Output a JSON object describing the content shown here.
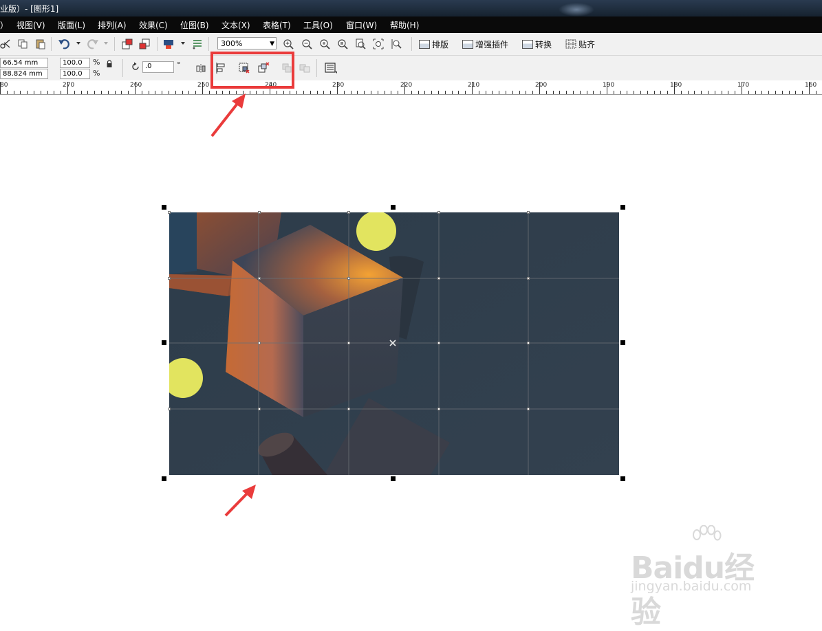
{
  "window": {
    "title": "业版）- [图形1]"
  },
  "menu": [
    "）",
    "视图(V)",
    "版面(L)",
    "排列(A)",
    "效果(C)",
    "位图(B)",
    "文本(X)",
    "表格(T)",
    "工具(O)",
    "窗口(W)",
    "帮助(H)"
  ],
  "toolbar": {
    "zoom_value": "300%",
    "plugins": [
      "排版",
      "增强插件",
      "转换",
      "贴齐"
    ]
  },
  "property_bar": {
    "width_value": "66.54 mm",
    "height_value": "88.824 mm",
    "scale_x": "100.0",
    "scale_y": "100.0",
    "percent_sign": "%",
    "rotation_value": ".0",
    "degree_sign": "°"
  },
  "ruler": {
    "labels": [
      "80",
      "270",
      "260",
      "250",
      "240",
      "230",
      "220",
      "210",
      "200",
      "190",
      "180",
      "170",
      "160"
    ]
  },
  "watermark": {
    "logo": "Baidu经验",
    "url": "jingyan.baidu.com"
  },
  "colors": {
    "accent_red": "#ea3b3b",
    "image_bg": "#2f3d4b",
    "cube_orange": "#e08a3c",
    "circle_yellow": "#e2e45f"
  }
}
